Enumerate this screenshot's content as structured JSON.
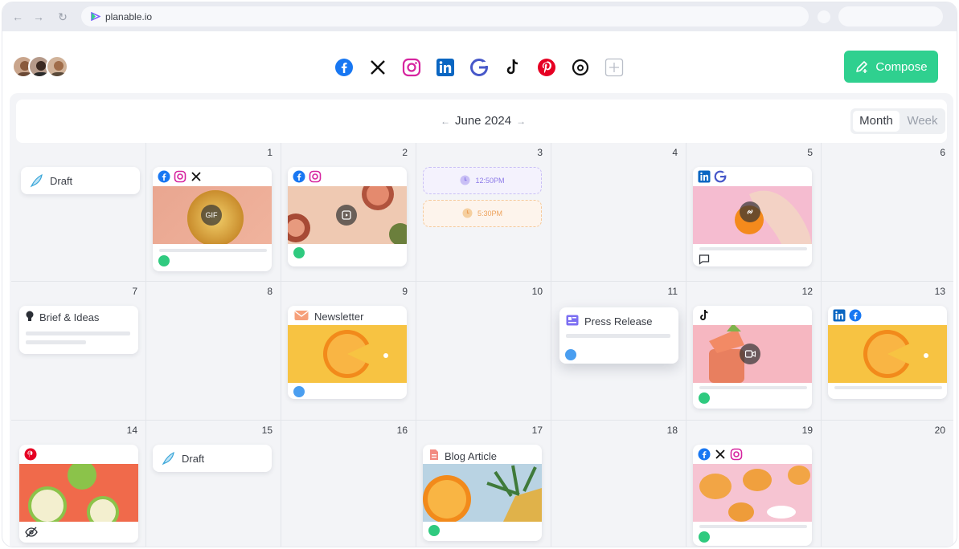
{
  "browser": {
    "url": "planable.io"
  },
  "toolbar": {
    "compose_label": "Compose"
  },
  "calendar": {
    "month_label": "June 2024",
    "view_month": "Month",
    "view_week": "Week"
  },
  "days": {
    "d1": "1",
    "d2": "2",
    "d3": "3",
    "d4": "4",
    "d5": "5",
    "d6": "6",
    "d7": "7",
    "d8": "8",
    "d9": "9",
    "d10": "10",
    "d11": "11",
    "d12": "12",
    "d13": "13",
    "d14": "14",
    "d15": "15",
    "d16": "16",
    "d17": "17",
    "d18": "18",
    "d19": "19",
    "d20": "20"
  },
  "cards": {
    "draft": "Draft",
    "brief": "Brief & Ideas",
    "newsletter": "Newsletter",
    "press": "Press Release",
    "blog": "Blog Article",
    "draft2": "Draft",
    "gif": "GIF"
  },
  "time_slots": {
    "a": "12:50PM",
    "b": "5:30PM"
  },
  "colors": {
    "accent": "#2fd08f",
    "facebook": "#1877f2",
    "linkedin": "#0a66c2",
    "pinterest": "#e60023",
    "instagram": "#d6249f"
  }
}
